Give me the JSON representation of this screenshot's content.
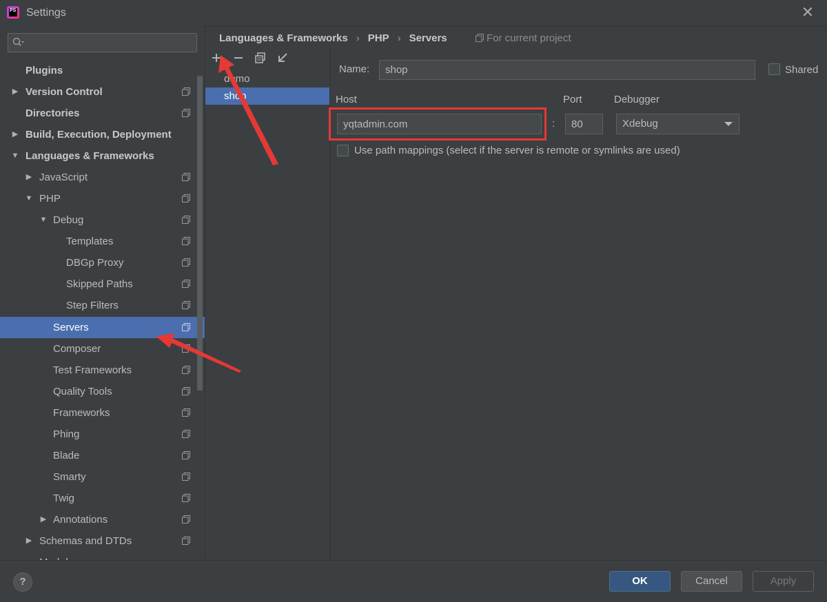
{
  "window": {
    "title": "Settings",
    "app_icon_text": "PS"
  },
  "search": {
    "placeholder": ""
  },
  "tree": {
    "items": [
      {
        "label": "Plugins"
      },
      {
        "label": "Version Control"
      },
      {
        "label": "Directories"
      },
      {
        "label": "Build, Execution, Deployment"
      },
      {
        "label": "Languages & Frameworks"
      },
      {
        "label": "JavaScript"
      },
      {
        "label": "PHP"
      },
      {
        "label": "Debug"
      },
      {
        "label": "Templates"
      },
      {
        "label": "DBGp Proxy"
      },
      {
        "label": "Skipped Paths"
      },
      {
        "label": "Step Filters"
      },
      {
        "label": "Servers"
      },
      {
        "label": "Composer"
      },
      {
        "label": "Test Frameworks"
      },
      {
        "label": "Quality Tools"
      },
      {
        "label": "Frameworks"
      },
      {
        "label": "Phing"
      },
      {
        "label": "Blade"
      },
      {
        "label": "Smarty"
      },
      {
        "label": "Twig"
      },
      {
        "label": "Annotations"
      },
      {
        "label": "Schemas and DTDs"
      },
      {
        "label": "Markdown"
      }
    ]
  },
  "breadcrumb": {
    "part1": "Languages & Frameworks",
    "part2": "PHP",
    "part3": "Servers",
    "separator": "›",
    "scope": "For current project"
  },
  "servers": {
    "items": [
      "demo",
      "shop"
    ],
    "selected": "shop"
  },
  "form": {
    "name_label": "Name:",
    "name_value": "shop",
    "shared_label": "Shared",
    "host_label": "Host",
    "host_value": "yqtadmin.com",
    "colon": ":",
    "port_label": "Port",
    "port_value": "80",
    "debugger_label": "Debugger",
    "debugger_value": "Xdebug",
    "path_mappings_label": "Use path mappings (select if the server is remote or symlinks are used)"
  },
  "footer": {
    "help": "?",
    "ok": "OK",
    "cancel": "Cancel",
    "apply": "Apply"
  },
  "colors": {
    "selection": "#4b6eaf",
    "highlight": "#e53935",
    "ok_button": "#365880"
  }
}
